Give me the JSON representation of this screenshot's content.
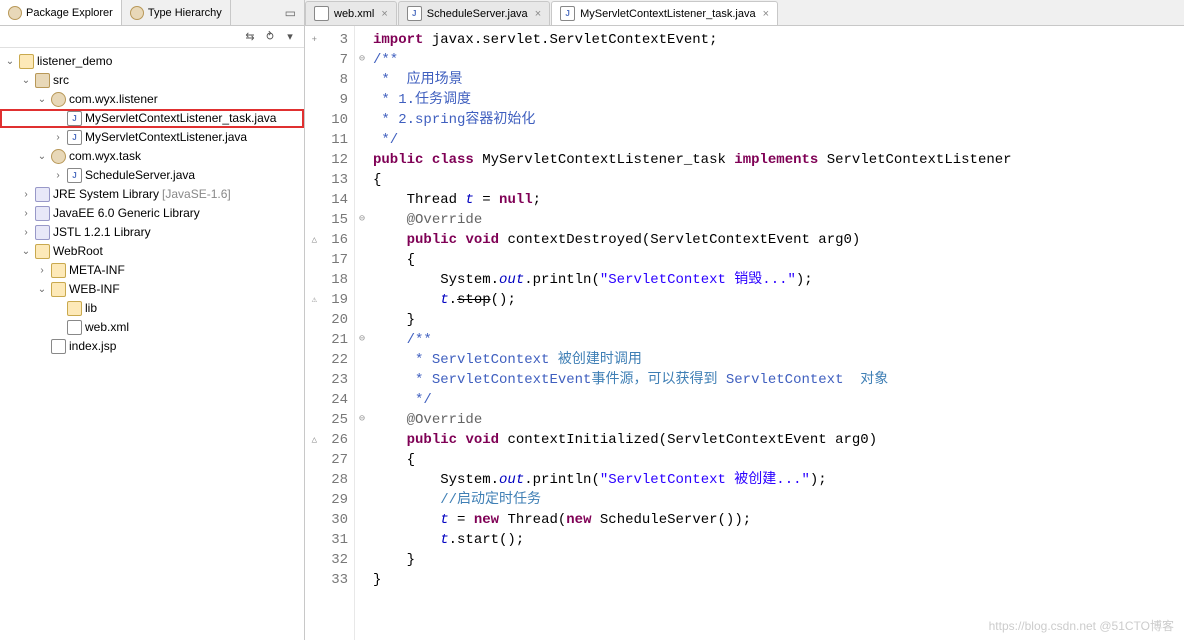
{
  "sidebar": {
    "tabs": [
      {
        "label": "Package Explorer",
        "active": true
      },
      {
        "label": "Type Hierarchy",
        "active": false
      }
    ],
    "tree": [
      {
        "indent": 0,
        "twisty": "v",
        "icon": "i-proj",
        "label": "listener_demo",
        "hl": false
      },
      {
        "indent": 1,
        "twisty": "v",
        "icon": "i-src",
        "label": "src",
        "hl": false
      },
      {
        "indent": 2,
        "twisty": "v",
        "icon": "i-pkg",
        "label": "com.wyx.listener",
        "hl": false
      },
      {
        "indent": 3,
        "twisty": "",
        "icon": "i-java",
        "label": "MyServletContextListener_task.java",
        "hl": true
      },
      {
        "indent": 3,
        "twisty": ">",
        "icon": "i-java",
        "label": "MyServletContextListener.java",
        "hl": false
      },
      {
        "indent": 2,
        "twisty": "v",
        "icon": "i-pkg",
        "label": "com.wyx.task",
        "hl": false
      },
      {
        "indent": 3,
        "twisty": ">",
        "icon": "i-java",
        "label": "ScheduleServer.java",
        "hl": false
      },
      {
        "indent": 1,
        "twisty": ">",
        "icon": "i-lib",
        "label": "JRE System Library",
        "suffix": "[JavaSE-1.6]",
        "hl": false
      },
      {
        "indent": 1,
        "twisty": ">",
        "icon": "i-lib",
        "label": "JavaEE 6.0 Generic Library",
        "hl": false
      },
      {
        "indent": 1,
        "twisty": ">",
        "icon": "i-lib",
        "label": "JSTL 1.2.1 Library",
        "hl": false
      },
      {
        "indent": 1,
        "twisty": "v",
        "icon": "i-folder",
        "label": "WebRoot",
        "hl": false
      },
      {
        "indent": 2,
        "twisty": ">",
        "icon": "i-folder",
        "label": "META-INF",
        "hl": false
      },
      {
        "indent": 2,
        "twisty": "v",
        "icon": "i-folder",
        "label": "WEB-INF",
        "hl": false
      },
      {
        "indent": 3,
        "twisty": "",
        "icon": "i-folder",
        "label": "lib",
        "hl": false
      },
      {
        "indent": 3,
        "twisty": "",
        "icon": "i-xml",
        "label": "web.xml",
        "hl": false
      },
      {
        "indent": 2,
        "twisty": "",
        "icon": "i-jsp",
        "label": "index.jsp",
        "hl": false
      }
    ]
  },
  "editor": {
    "tabs": [
      {
        "label": "web.xml",
        "icon": "i-xml",
        "active": false
      },
      {
        "label": "ScheduleServer.java",
        "icon": "i-java",
        "active": false
      },
      {
        "label": "MyServletContextListener_task.java",
        "icon": "i-java",
        "active": true
      }
    ],
    "lines": [
      {
        "n": "3",
        "mark": "+",
        "fold": "",
        "html": "<span class='kw'>import</span> javax.servlet.ServletContextEvent;"
      },
      {
        "n": "7",
        "mark": "",
        "fold": "⊖",
        "html": "<span class='docc'>/**</span>"
      },
      {
        "n": "8",
        "mark": "",
        "fold": "",
        "html": " <span class='docc'>*  应用场景</span>"
      },
      {
        "n": "9",
        "mark": "",
        "fold": "",
        "html": " <span class='docc'>* 1.任务调度</span>"
      },
      {
        "n": "10",
        "mark": "",
        "fold": "",
        "html": " <span class='docc'>* 2.spring容器初始化</span>"
      },
      {
        "n": "11",
        "mark": "",
        "fold": "",
        "html": " <span class='docc'>*/</span>"
      },
      {
        "n": "12",
        "mark": "",
        "fold": "",
        "html": "<span class='kw'>public</span> <span class='kw'>class</span> MyServletContextListener_task <span class='kw'>implements</span> ServletContextListener"
      },
      {
        "n": "13",
        "mark": "",
        "fold": "",
        "html": "{"
      },
      {
        "n": "14",
        "mark": "",
        "fold": "",
        "html": "    Thread <span class='field'>t</span> = <span class='kw'>null</span>;"
      },
      {
        "n": "15",
        "mark": "",
        "fold": "⊖",
        "html": "    <span class='ann'>@Override</span>"
      },
      {
        "n": "16",
        "mark": "△",
        "fold": "",
        "html": "    <span class='kw'>public</span> <span class='kw'>void</span> contextDestroyed(ServletContextEvent arg0)"
      },
      {
        "n": "17",
        "mark": "",
        "fold": "",
        "html": "    {"
      },
      {
        "n": "18",
        "mark": "",
        "fold": "",
        "html": "        System.<span class='field'>out</span>.println(<span class='str'>\"ServletContext 销毁...\"</span>);"
      },
      {
        "n": "19",
        "mark": "⚠",
        "fold": "",
        "html": "        <span class='field'>t</span>.<span class='strike'>stop</span>();"
      },
      {
        "n": "20",
        "mark": "",
        "fold": "",
        "html": "    }"
      },
      {
        "n": "21",
        "mark": "",
        "fold": "⊖",
        "html": "    <span class='docc'>/**</span>"
      },
      {
        "n": "22",
        "mark": "",
        "fold": "",
        "html": "     <span class='docc'>* ServletContext</span> <span class='comment'>被创建时调用</span>"
      },
      {
        "n": "23",
        "mark": "",
        "fold": "",
        "html": "     <span class='docc'>* ServletContextEvent</span><span class='comment'>事件源，可以获得到</span> <span class='docc'>ServletContext</span>  <span class='comment'>对象</span>"
      },
      {
        "n": "24",
        "mark": "",
        "fold": "",
        "html": "     <span class='docc'>*/</span>"
      },
      {
        "n": "25",
        "mark": "",
        "fold": "⊖",
        "html": "    <span class='ann'>@Override</span>"
      },
      {
        "n": "26",
        "mark": "△",
        "fold": "",
        "html": "    <span class='kw'>public</span> <span class='kw'>void</span> contextInitialized(ServletContextEvent arg0)"
      },
      {
        "n": "27",
        "mark": "",
        "fold": "",
        "html": "    {"
      },
      {
        "n": "28",
        "mark": "",
        "fold": "",
        "html": "        System.<span class='field'>out</span>.println(<span class='str'>\"ServletContext 被创建...\"</span>);"
      },
      {
        "n": "29",
        "mark": "",
        "fold": "",
        "html": "        <span class='comment'>//启动定时任务</span>"
      },
      {
        "n": "30",
        "mark": "",
        "fold": "",
        "html": "        <span class='field'>t</span> = <span class='kw'>new</span> Thread(<span class='kw'>new</span> ScheduleServer());"
      },
      {
        "n": "31",
        "mark": "",
        "fold": "",
        "html": "        <span class='field'>t</span>.start();"
      },
      {
        "n": "32",
        "mark": "",
        "fold": "",
        "html": "    }"
      },
      {
        "n": "33",
        "mark": "",
        "fold": "",
        "html": "}"
      }
    ]
  },
  "watermark": "https://blog.csdn.net @51CTO博客"
}
